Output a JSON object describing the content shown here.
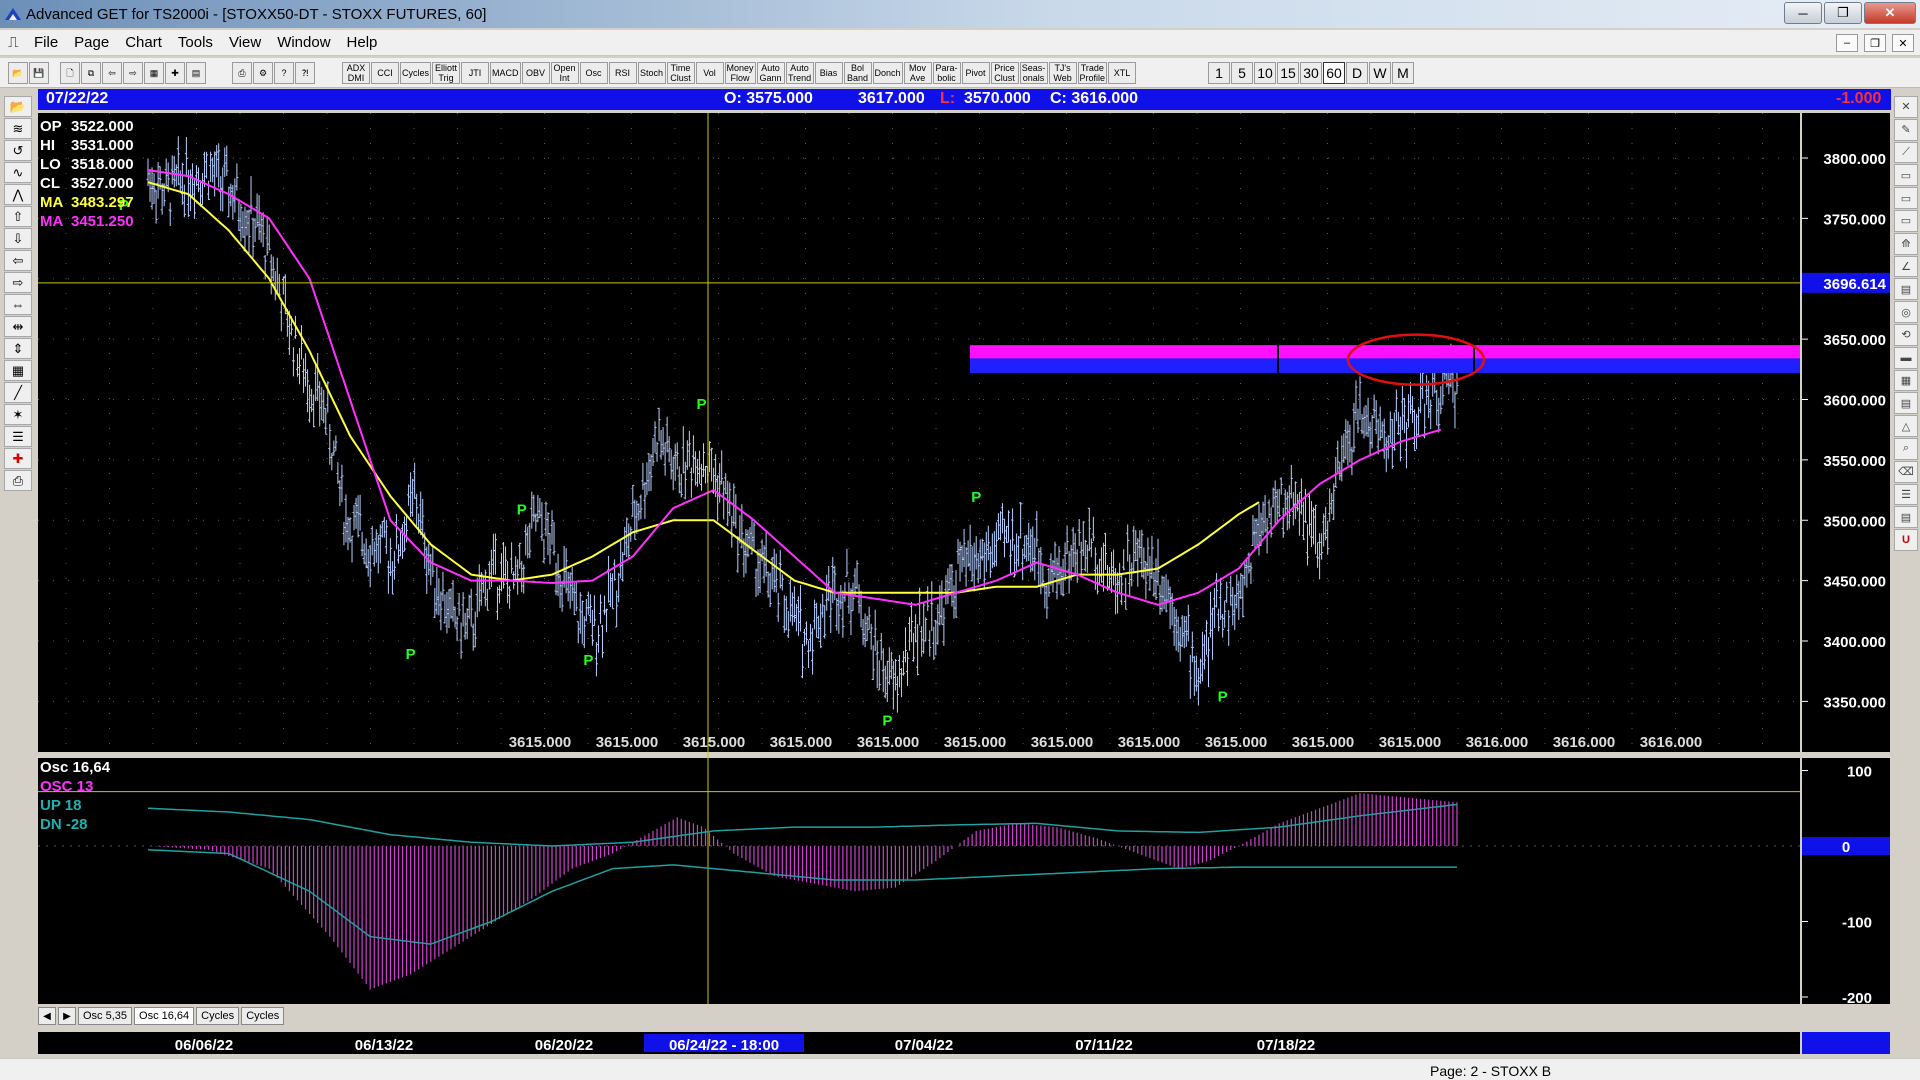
{
  "window": {
    "title": "Advanced GET for TS2000i - [STOXX50-DT - STOXX FUTURES, 60]",
    "buttons": {
      "minimize": "─",
      "maximize": "❐",
      "close": "✕"
    }
  },
  "menu": {
    "items": [
      "File",
      "Page",
      "Chart",
      "Tools",
      "View",
      "Window",
      "Help"
    ],
    "mdi_buttons": [
      "‒",
      "❐",
      "✕"
    ]
  },
  "toolbar": {
    "file_icons": [
      "📂",
      "💾",
      "🖨",
      "?"
    ],
    "study_buttons": [
      "ADX\nDMI",
      "CCI",
      "Cycles",
      "Elliott\nTrig",
      "JTI",
      "MACD",
      "OBV",
      "Open\nInt",
      "Osc",
      "RSI",
      "Stoch",
      "Time\nClust",
      "Vol",
      "Money\nFlow",
      "Auto\nGann",
      "Auto\nTrend",
      "Bias",
      "Bol\nBand",
      "Donch",
      "Mov\nAve",
      "Para-\nbolic",
      "Pivot",
      "Price\nClust",
      "Seas-\nonals",
      "TJ's\nWeb",
      "Trade\nProfile",
      "XTL"
    ],
    "periods": [
      "1",
      "5",
      "10",
      "15",
      "30",
      "60",
      "D",
      "W",
      "M"
    ],
    "active_period": "60"
  },
  "infobar": {
    "date": "07/22/22",
    "open": "O: 3575.000",
    "high": "3617.000",
    "low_label": "L:",
    "low": "3570.000",
    "close": "C: 3616.000",
    "change": "-1.000"
  },
  "price_panel": {
    "legend": [
      {
        "label": "OP",
        "value": "3522.000",
        "color": "#ffffff"
      },
      {
        "label": "HI",
        "value": "3531.000",
        "color": "#ffffff"
      },
      {
        "label": "LO",
        "value": "3518.000",
        "color": "#ffffff"
      },
      {
        "label": "CL",
        "value": "3527.000",
        "color": "#ffffff"
      },
      {
        "label": "MA",
        "value": "3483.297",
        "color": "#ffff40"
      },
      {
        "label": "MA",
        "value": "3451.250",
        "color": "#ff30ff"
      }
    ],
    "y_ticks": [
      "3800.000",
      "3750.000",
      "3650.000",
      "3600.000",
      "3550.000",
      "3500.000",
      "3450.000",
      "3400.000",
      "3350.000"
    ],
    "crosshair_price": "3696.614",
    "bottom_values": [
      "3615.000",
      "3615.000",
      "3615.000",
      "3615.000",
      "3615.000",
      "3615.000",
      "3615.000",
      "3615.000",
      "3615.000",
      "3615.000",
      "3615.000",
      "3616.000",
      "3616.000",
      "3616.000"
    ],
    "pivot_label": "P",
    "colors": {
      "bars": "#b8d0ff",
      "ma_fast": "#ffff40",
      "ma_slow": "#ff30ff",
      "zone_top": "#ff10ff",
      "zone_bottom": "#2020ff",
      "circle": "#e01010",
      "pivot": "#20ff20"
    }
  },
  "osc_panel": {
    "legend": [
      {
        "label": "Osc 16,64",
        "color": "#ffffff"
      },
      {
        "label": "OSC 13",
        "color": "#ff30ff"
      },
      {
        "label": "UP   18",
        "color": "#20b0b0"
      },
      {
        "label": "DN   -28",
        "color": "#20b0b0"
      }
    ],
    "y_ticks": [
      "100",
      "-100",
      "-200"
    ],
    "zero_label": "0"
  },
  "tabs": {
    "items": [
      "Osc 5,35",
      "Osc 16,64",
      "Cycles",
      "Cycles"
    ],
    "active": "Osc 16,64"
  },
  "date_axis": {
    "labels": [
      "06/06/22",
      "06/13/22",
      "06/20/22",
      "06/24/22 - 18:00",
      "07/04/22",
      "07/11/22",
      "07/18/22"
    ]
  },
  "status": {
    "page": "Page: 2 - STOXX B"
  },
  "chart_data": {
    "type": "line",
    "title": "STOXX50-DT - STOXX FUTURES, 60",
    "xlabel": "",
    "ylabel": "",
    "x": [
      "06/06/22",
      "06/13/22",
      "06/20/22",
      "06/24/22",
      "07/04/22",
      "07/11/22",
      "07/18/22",
      "07/22/22"
    ],
    "ylim": [
      3325,
      3830
    ],
    "series": [
      {
        "name": "",
        "values": [
          3790,
          3580,
          3450,
          3560,
          3380,
          3480,
          3460,
          3616
        ]
      },
      {
        "name": "MA",
        "values": [
          3780,
          3620,
          3460,
          3500,
          3440,
          3450,
          3470,
          3483.297
        ]
      },
      {
        "name": "MA",
        "values": [
          3785,
          3680,
          3470,
          3450,
          3510,
          3440,
          3430,
          3451.25
        ]
      }
    ],
    "price_path": [
      [
        0,
        3785
      ],
      [
        10,
        3770
      ],
      [
        18,
        3785
      ],
      [
        30,
        3790
      ],
      [
        42,
        3770
      ],
      [
        55,
        3740
      ],
      [
        62,
        3710
      ],
      [
        70,
        3660
      ],
      [
        78,
        3620
      ],
      [
        88,
        3590
      ],
      [
        98,
        3500
      ],
      [
        110,
        3480
      ],
      [
        122,
        3470
      ],
      [
        132,
        3520
      ],
      [
        140,
        3460
      ],
      [
        150,
        3420
      ],
      [
        160,
        3410
      ],
      [
        170,
        3460
      ],
      [
        182,
        3445
      ],
      [
        192,
        3500
      ],
      [
        200,
        3480
      ],
      [
        212,
        3420
      ],
      [
        222,
        3410
      ],
      [
        232,
        3450
      ],
      [
        244,
        3520
      ],
      [
        252,
        3570
      ],
      [
        262,
        3540
      ],
      [
        272,
        3555
      ],
      [
        284,
        3530
      ],
      [
        292,
        3490
      ],
      [
        304,
        3460
      ],
      [
        316,
        3430
      ],
      [
        326,
        3400
      ],
      [
        338,
        3440
      ],
      [
        350,
        3445
      ],
      [
        360,
        3390
      ],
      [
        370,
        3360
      ],
      [
        380,
        3410
      ],
      [
        392,
        3420
      ],
      [
        402,
        3460
      ],
      [
        414,
        3470
      ],
      [
        426,
        3485
      ],
      [
        438,
        3480
      ],
      [
        446,
        3450
      ],
      [
        456,
        3470
      ],
      [
        468,
        3480
      ],
      [
        478,
        3450
      ],
      [
        490,
        3470
      ],
      [
        500,
        3460
      ],
      [
        510,
        3420
      ],
      [
        520,
        3370
      ],
      [
        530,
        3430
      ],
      [
        540,
        3430
      ],
      [
        550,
        3500
      ],
      [
        560,
        3510
      ],
      [
        570,
        3520
      ],
      [
        580,
        3470
      ],
      [
        590,
        3540
      ],
      [
        600,
        3590
      ],
      [
        612,
        3570
      ],
      [
        622,
        3580
      ],
      [
        632,
        3595
      ],
      [
        642,
        3610
      ],
      [
        648,
        3616
      ]
    ],
    "ma_fast_path": [
      [
        0,
        3780
      ],
      [
        20,
        3770
      ],
      [
        40,
        3740
      ],
      [
        60,
        3700
      ],
      [
        80,
        3640
      ],
      [
        100,
        3570
      ],
      [
        120,
        3520
      ],
      [
        140,
        3480
      ],
      [
        160,
        3455
      ],
      [
        180,
        3450
      ],
      [
        200,
        3455
      ],
      [
        220,
        3470
      ],
      [
        240,
        3490
      ],
      [
        260,
        3500
      ],
      [
        280,
        3500
      ],
      [
        300,
        3475
      ],
      [
        320,
        3450
      ],
      [
        340,
        3440
      ],
      [
        360,
        3440
      ],
      [
        380,
        3440
      ],
      [
        400,
        3440
      ],
      [
        420,
        3445
      ],
      [
        440,
        3445
      ],
      [
        460,
        3455
      ],
      [
        480,
        3455
      ],
      [
        500,
        3460
      ],
      [
        520,
        3480
      ],
      [
        540,
        3505
      ],
      [
        550,
        3515
      ]
    ],
    "ma_slow_path": [
      [
        0,
        3790
      ],
      [
        20,
        3785
      ],
      [
        40,
        3770
      ],
      [
        60,
        3750
      ],
      [
        80,
        3700
      ],
      [
        100,
        3600
      ],
      [
        120,
        3500
      ],
      [
        140,
        3465
      ],
      [
        160,
        3450
      ],
      [
        180,
        3450
      ],
      [
        200,
        3448
      ],
      [
        220,
        3450
      ],
      [
        240,
        3470
      ],
      [
        260,
        3510
      ],
      [
        280,
        3525
      ],
      [
        300,
        3500
      ],
      [
        320,
        3470
      ],
      [
        340,
        3440
      ],
      [
        360,
        3435
      ],
      [
        380,
        3430
      ],
      [
        400,
        3440
      ],
      [
        420,
        3450
      ],
      [
        440,
        3465
      ],
      [
        460,
        3455
      ],
      [
        480,
        3440
      ],
      [
        500,
        3430
      ],
      [
        520,
        3440
      ],
      [
        540,
        3460
      ],
      [
        560,
        3500
      ],
      [
        580,
        3530
      ],
      [
        600,
        3550
      ],
      [
        620,
        3565
      ],
      [
        640,
        3575
      ]
    ],
    "osc_path": [
      [
        0,
        0
      ],
      [
        30,
        -5
      ],
      [
        60,
        -30
      ],
      [
        90,
        -120
      ],
      [
        110,
        -190
      ],
      [
        130,
        -170
      ],
      [
        160,
        -120
      ],
      [
        190,
        -70
      ],
      [
        210,
        -30
      ],
      [
        230,
        -10
      ],
      [
        250,
        20
      ],
      [
        262,
        38
      ],
      [
        275,
        25
      ],
      [
        290,
        -10
      ],
      [
        310,
        -40
      ],
      [
        330,
        -50
      ],
      [
        350,
        -60
      ],
      [
        370,
        -55
      ],
      [
        390,
        -20
      ],
      [
        410,
        20
      ],
      [
        430,
        30
      ],
      [
        450,
        25
      ],
      [
        470,
        10
      ],
      [
        490,
        -10
      ],
      [
        510,
        -30
      ],
      [
        525,
        -20
      ],
      [
        540,
        0
      ],
      [
        560,
        30
      ],
      [
        580,
        50
      ],
      [
        600,
        70
      ],
      [
        620,
        65
      ],
      [
        640,
        60
      ],
      [
        648,
        58
      ]
    ],
    "osc_up_path": [
      [
        0,
        50
      ],
      [
        40,
        45
      ],
      [
        80,
        35
      ],
      [
        120,
        15
      ],
      [
        160,
        5
      ],
      [
        200,
        0
      ],
      [
        240,
        5
      ],
      [
        280,
        20
      ],
      [
        320,
        25
      ],
      [
        360,
        25
      ],
      [
        400,
        28
      ],
      [
        440,
        30
      ],
      [
        480,
        20
      ],
      [
        520,
        18
      ],
      [
        560,
        25
      ],
      [
        600,
        40
      ],
      [
        648,
        55
      ]
    ],
    "osc_dn_path": [
      [
        0,
        -5
      ],
      [
        40,
        -10
      ],
      [
        80,
        -60
      ],
      [
        110,
        -120
      ],
      [
        140,
        -130
      ],
      [
        170,
        -100
      ],
      [
        200,
        -60
      ],
      [
        230,
        -30
      ],
      [
        260,
        -25
      ],
      [
        300,
        -35
      ],
      [
        340,
        -45
      ],
      [
        380,
        -45
      ],
      [
        420,
        -40
      ],
      [
        460,
        -35
      ],
      [
        500,
        -30
      ],
      [
        540,
        -28
      ],
      [
        600,
        -28
      ],
      [
        648,
        -28
      ]
    ],
    "osc_ylim": [
      -220,
      110
    ],
    "zone": {
      "high": 3645,
      "mid": 3634,
      "low": 3622
    },
    "pivots": [
      [
        -12,
        3752,
        "top"
      ],
      [
        130,
        3400,
        "bot"
      ],
      [
        185,
        3500,
        "top"
      ],
      [
        218,
        3395,
        "bot"
      ],
      [
        274,
        3587,
        "top"
      ],
      [
        366,
        3345,
        "bot"
      ],
      [
        410,
        3510,
        "top"
      ],
      [
        532,
        3365,
        "bot"
      ]
    ],
    "bar_count": 650
  }
}
